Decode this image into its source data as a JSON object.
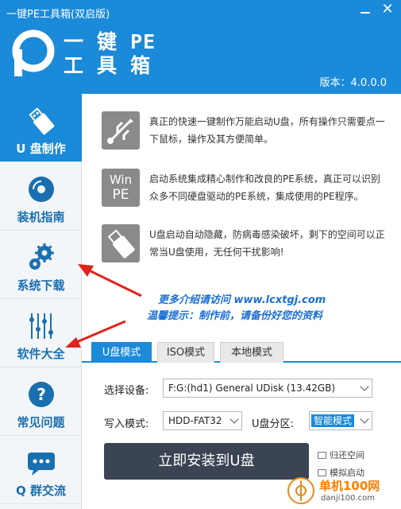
{
  "window": {
    "title": "一键PE工具箱(双启版)",
    "close_glyph": "✕"
  },
  "header": {
    "logo_line1": "一 键 PE",
    "logo_line2": "工 具 箱",
    "version": "版本：4.0.0.0"
  },
  "sidebar": {
    "items": [
      {
        "label": "U 盘制作",
        "icon": "usb-drive-icon"
      },
      {
        "label": "装机指南",
        "icon": "disc-icon"
      },
      {
        "label": "系统下载",
        "icon": "gears-icon"
      },
      {
        "label": "软件大全",
        "icon": "circuit-icon"
      },
      {
        "label": "常见问题",
        "icon": "question-icon"
      },
      {
        "label": "Q 群交流",
        "icon": "chat-icon"
      }
    ]
  },
  "features": [
    {
      "icon": "usb-symbol-icon",
      "text": "真正的快速一键制作万能启动U盘，所有操作只需要点一下鼠标，操作及其方便简单。"
    },
    {
      "icon": "win-pe-icon",
      "icon_line1": "Win",
      "icon_line2": "PE",
      "text": "启动系统集成精心制作和改良的PE系统，真正可以识别众多不同硬盘驱动的PE系统，集成使用的PE程序。"
    },
    {
      "icon": "usb-stick-icon",
      "text": "U盘启动自动隐藏，防病毒感染破坏，剩下的空间可以正常当U盘使用，无任何干扰影响!"
    }
  ],
  "promo": {
    "line1": "更多介绍请访问 www.lcxtgj.com",
    "line2": "温馨提示：制作前，请备份好您的资料"
  },
  "tabs": [
    "U盘模式",
    "ISO模式",
    "本地模式"
  ],
  "form": {
    "device_label": "选择设备:",
    "device_value": "F:G:(hd1) General UDisk  (13.42GB)",
    "write_label": "写入模式:",
    "write_value": "HDD-FAT32",
    "partition_label": "U盘分区:",
    "partition_value": "智能模式"
  },
  "install_button": "立即安装到U盘",
  "options": [
    "归还空间",
    "模拟启动"
  ],
  "watermark": {
    "line1": "单机100网",
    "line2": "danji100.com"
  },
  "colors": {
    "accent": "#1a8ad9",
    "button": "#3a4452",
    "arrow": "#e0241c"
  }
}
